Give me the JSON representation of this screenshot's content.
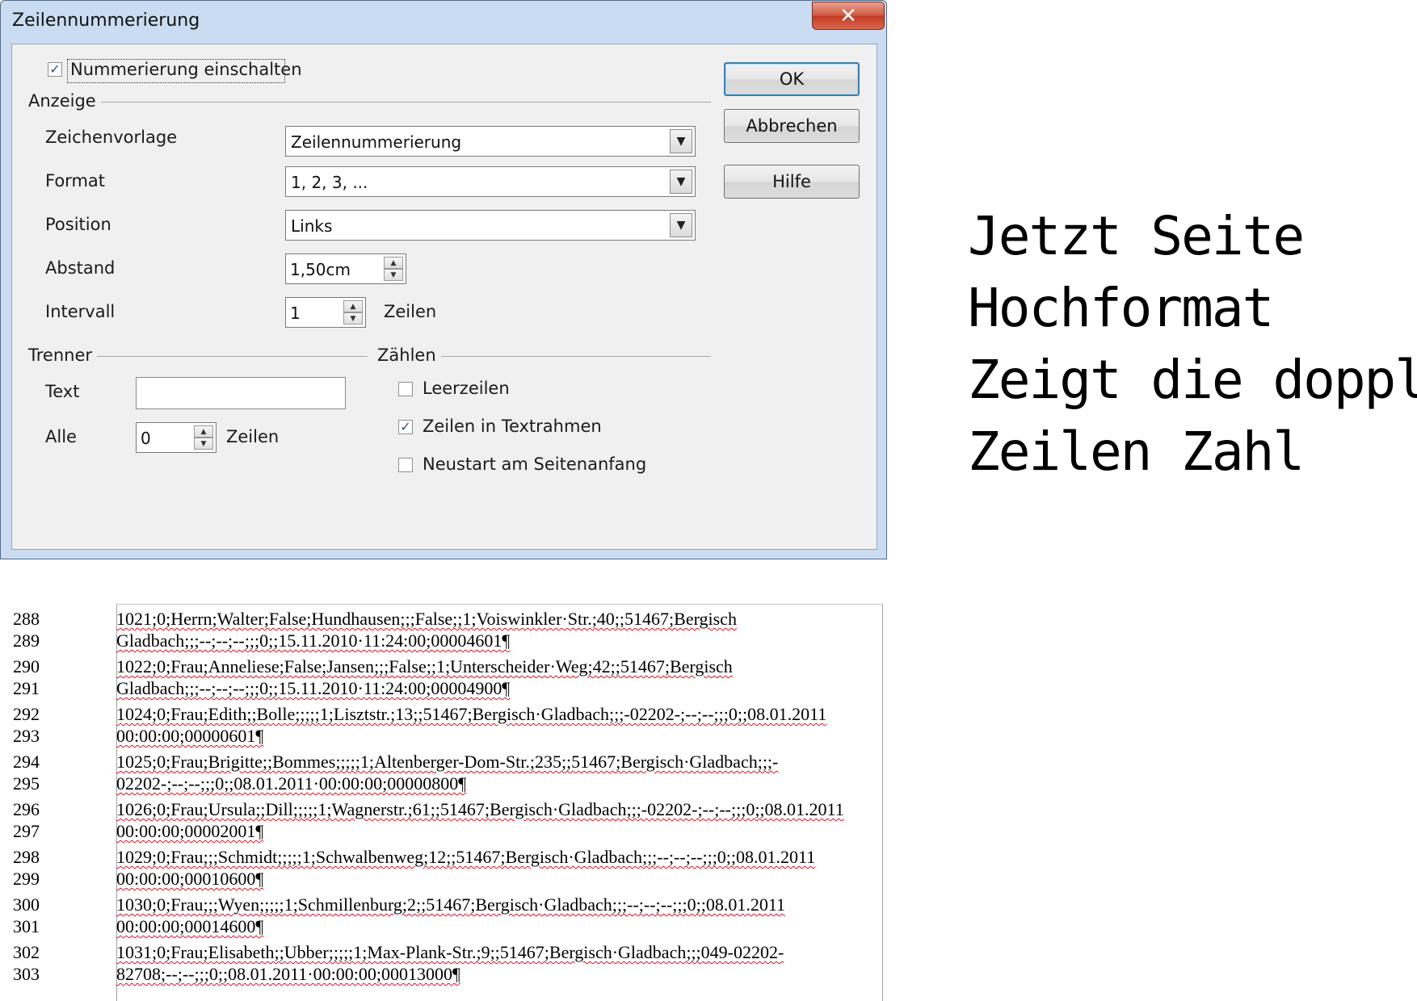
{
  "dialog": {
    "title": "Zeilennummerierung",
    "close_glyph": "✕",
    "enable_numbering": {
      "label": "Nummerierung einschalten",
      "checked": true,
      "check_glyph": "✓"
    },
    "groups": {
      "anzeige": "Anzeige",
      "trenner": "Trenner",
      "zaehlen": "Zählen"
    },
    "anzeige": {
      "zeichenvorlage": {
        "label": "Zeichenvorlage",
        "value": "Zeilennummerierung"
      },
      "format": {
        "label": "Format",
        "value": "1, 2, 3, ..."
      },
      "position": {
        "label": "Position",
        "value": "Links"
      },
      "abstand": {
        "label": "Abstand",
        "value": "1,50cm"
      },
      "intervall": {
        "label": "Intervall",
        "value": "1",
        "unit": "Zeilen"
      }
    },
    "trenner": {
      "text": {
        "label": "Text",
        "value": ""
      },
      "alle": {
        "label": "Alle",
        "value": "0",
        "unit": "Zeilen"
      }
    },
    "zaehlen": {
      "leerzeilen": {
        "label": "Leerzeilen",
        "checked": false
      },
      "textrahmen": {
        "label": "Zeilen in Textrahmen",
        "checked": true,
        "check_glyph": "✓"
      },
      "neustart": {
        "label": "Neustart am Seitenanfang",
        "checked": false
      }
    },
    "buttons": {
      "ok": "OK",
      "cancel": "Abbrechen",
      "help": "Hilfe"
    },
    "combo_arrow_glyph": "▼",
    "spin_up_glyph": "▲",
    "spin_down_glyph": "▼"
  },
  "note": {
    "lines": [
      "Jetzt Seite",
      "Hochformat",
      "Zeigt die dopplte",
      "Zeilen Zahl"
    ]
  },
  "document": {
    "lines": [
      {
        "number": "288",
        "text": "1021;0;Herrn;Walter;False;Hundhausen;;;False;;1;Voiswinkler·Str.;40;;51467;Bergisch"
      },
      {
        "number": "289",
        "text": "Gladbach;;;--;--;--;;;0;;15.11.2010·11:24:00;00004601¶"
      },
      {
        "number": "290",
        "text": "1022;0;Frau;Anneliese;False;Jansen;;;False;;1;Unterscheider·Weg;42;;51467;Bergisch"
      },
      {
        "number": "291",
        "text": "Gladbach;;;--;--;--;;;0;;15.11.2010·11:24:00;00004900¶"
      },
      {
        "number": "292",
        "text": "1024;0;Frau;Edith;;Bolle;;;;;1;Lisztstr.;13;;51467;Bergisch·Gladbach;;;-02202-;--;--;;;0;;08.01.2011"
      },
      {
        "number": "293",
        "text": "00:00:00;00000601¶"
      },
      {
        "number": "294",
        "text": "1025;0;Frau;Brigitte;;Bommes;;;;;1;Altenberger-Dom-Str.;235;;51467;Bergisch·Gladbach;;;-"
      },
      {
        "number": "295",
        "text": "02202-;--;--;;;0;;08.01.2011·00:00:00;00000800¶"
      },
      {
        "number": "296",
        "text": "1026;0;Frau;Ursula;;Dill;;;;;1;Wagnerstr.;61;;51467;Bergisch·Gladbach;;;-02202-;--;--;;;0;;08.01.2011"
      },
      {
        "number": "297",
        "text": "00:00:00;00002001¶"
      },
      {
        "number": "298",
        "text": "1029;0;Frau;;;Schmidt;;;;;1;Schwalbenweg;12;;51467;Bergisch·Gladbach;;;--;--;--;;;0;;08.01.2011"
      },
      {
        "number": "299",
        "text": "00:00:00;00010600¶"
      },
      {
        "number": "300",
        "text": "1030;0;Frau;;;Wyen;;;;;1;Schmillenburg;2;;51467;Bergisch·Gladbach;;;--;--;--;;;0;;08.01.2011"
      },
      {
        "number": "301",
        "text": "00:00:00;00014600¶"
      },
      {
        "number": "302",
        "text": "1031;0;Frau;Elisabeth;;Ubber;;;;;1;Max-Plank-Str.;9;;51467;Bergisch·Gladbach;;;049-02202-"
      },
      {
        "number": "303",
        "text": "82708;--;--;;;0;;08.01.2011·00:00:00;00013000¶"
      }
    ]
  }
}
